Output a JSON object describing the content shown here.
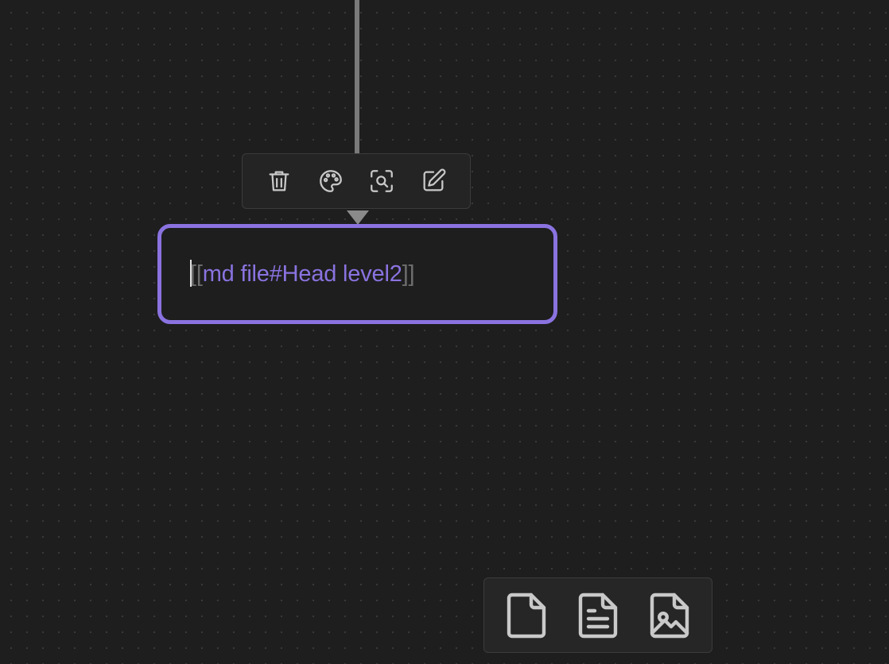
{
  "canvas": {
    "background": "#1e1e1e",
    "dot_color": "#3a3a3a",
    "accent": "#8a73e0"
  },
  "node_toolbar": {
    "buttons": [
      {
        "icon": "trash-icon",
        "name": "delete-button"
      },
      {
        "icon": "palette-icon",
        "name": "color-button"
      },
      {
        "icon": "zoom-to-selection-icon",
        "name": "zoom-button"
      },
      {
        "icon": "edit-icon",
        "name": "edit-button"
      }
    ]
  },
  "text_node": {
    "open_brackets": "[[",
    "link_text": "md file#Head level2",
    "close_brackets": "]]"
  },
  "create_toolbar": {
    "buttons": [
      {
        "icon": "blank-card-icon",
        "name": "add-card-button"
      },
      {
        "icon": "note-file-icon",
        "name": "add-note-button"
      },
      {
        "icon": "media-file-icon",
        "name": "add-media-button"
      }
    ]
  }
}
